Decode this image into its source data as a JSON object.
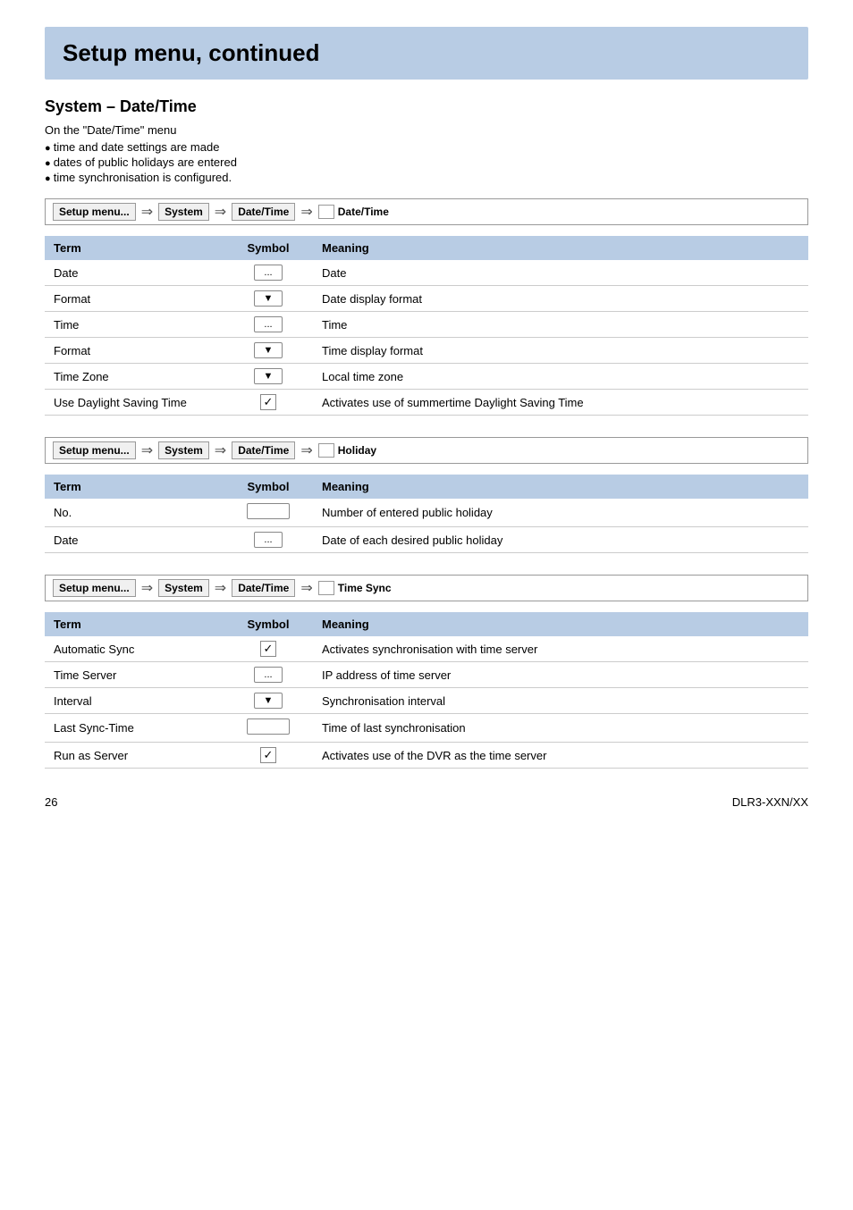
{
  "header": {
    "title": "Setup menu, continued",
    "bg_color": "#b8cce4"
  },
  "section1": {
    "title": "System – Date/Time",
    "intro": "On the \"Date/Time\" menu",
    "bullets": [
      "time and date settings are made",
      "dates of public holidays are entered",
      "time synchronisation is configured."
    ]
  },
  "nav1": {
    "items": [
      "Setup menu...",
      "System",
      "Date/Time"
    ],
    "destination": "Date/Time"
  },
  "nav2": {
    "items": [
      "Setup menu...",
      "System",
      "Date/Time"
    ],
    "destination": "Holiday"
  },
  "nav3": {
    "items": [
      "Setup menu...",
      "System",
      "Date/Time"
    ],
    "destination": "Time Sync"
  },
  "table1": {
    "headers": [
      "Term",
      "Symbol",
      "Meaning"
    ],
    "rows": [
      {
        "term": "Date",
        "symbol": "ellipsis",
        "meaning": "Date"
      },
      {
        "term": "Format",
        "symbol": "dropdown",
        "meaning": "Date display format"
      },
      {
        "term": "Time",
        "symbol": "ellipsis",
        "meaning": "Time"
      },
      {
        "term": "Format",
        "symbol": "dropdown",
        "meaning": "Time display format"
      },
      {
        "term": "Time Zone",
        "symbol": "dropdown",
        "meaning": "Local time zone"
      },
      {
        "term": "Use Daylight Saving Time",
        "symbol": "checkbox",
        "meaning": "Activates use of summertime Daylight Saving Time"
      }
    ]
  },
  "table2": {
    "headers": [
      "Term",
      "Symbol",
      "Meaning"
    ],
    "rows": [
      {
        "term": "No.",
        "symbol": "box",
        "meaning": "Number of entered public holiday"
      },
      {
        "term": "Date",
        "symbol": "ellipsis",
        "meaning": "Date of each desired public holiday"
      }
    ]
  },
  "table3": {
    "headers": [
      "Term",
      "Symbol",
      "Meaning"
    ],
    "rows": [
      {
        "term": "Automatic Sync",
        "symbol": "checkbox",
        "meaning": "Activates synchronisation with time server"
      },
      {
        "term": "Time Server",
        "symbol": "ellipsis",
        "meaning": "IP address of time server"
      },
      {
        "term": "Interval",
        "symbol": "dropdown",
        "meaning": "Synchronisation interval"
      },
      {
        "term": "Last Sync-Time",
        "symbol": "box",
        "meaning": "Time of last synchronisation"
      },
      {
        "term": "Run as Server",
        "symbol": "checkbox",
        "meaning": "Activates use of the DVR as the time server"
      }
    ]
  },
  "footer": {
    "page_number": "26",
    "model": "DLR3-XXN/XX"
  }
}
